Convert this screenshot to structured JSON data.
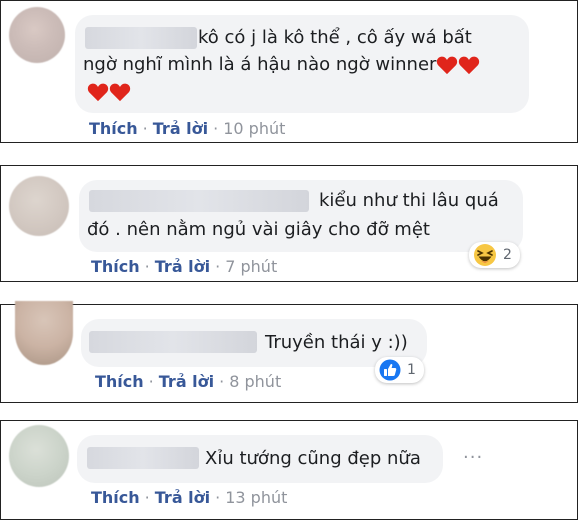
{
  "comments": [
    {
      "text_line1": "kô có j là kô thể , cô ấy wá bất",
      "text_line2": "ngờ nghĩ mình là á hậu nào ngờ winner",
      "like_label": "Thích",
      "reply_label": "Trả lời",
      "time": "10 phút",
      "separator": "·"
    },
    {
      "text_line1": "kiểu như thi lâu quá",
      "text_line2": "đó . nên nằm ngủ vài giây cho đỡ mệt",
      "like_label": "Thích",
      "reply_label": "Trả lời",
      "time": "7 phút",
      "separator": "·",
      "reaction_icon": "haha-emoji-icon",
      "reaction_count": "2"
    },
    {
      "text_line1": "Truyền thái y :))",
      "like_label": "Thích",
      "reply_label": "Trả lời",
      "time": "8 phút",
      "separator": "·",
      "reaction_icon": "like-thumb-icon",
      "reaction_count": "1"
    },
    {
      "text_line1": "Xỉu tướng cũng đẹp nữa",
      "like_label": "Thích",
      "reply_label": "Trả lời",
      "time": "13 phút",
      "separator": "·",
      "more_icon": "more-options-icon"
    }
  ],
  "colors": {
    "link": "#385898",
    "meta": "#90949c",
    "bubble": "#f2f3f5",
    "heart": "#e0251b",
    "like_blue": "#1877f2",
    "haha_yellow": "#f7c744"
  }
}
